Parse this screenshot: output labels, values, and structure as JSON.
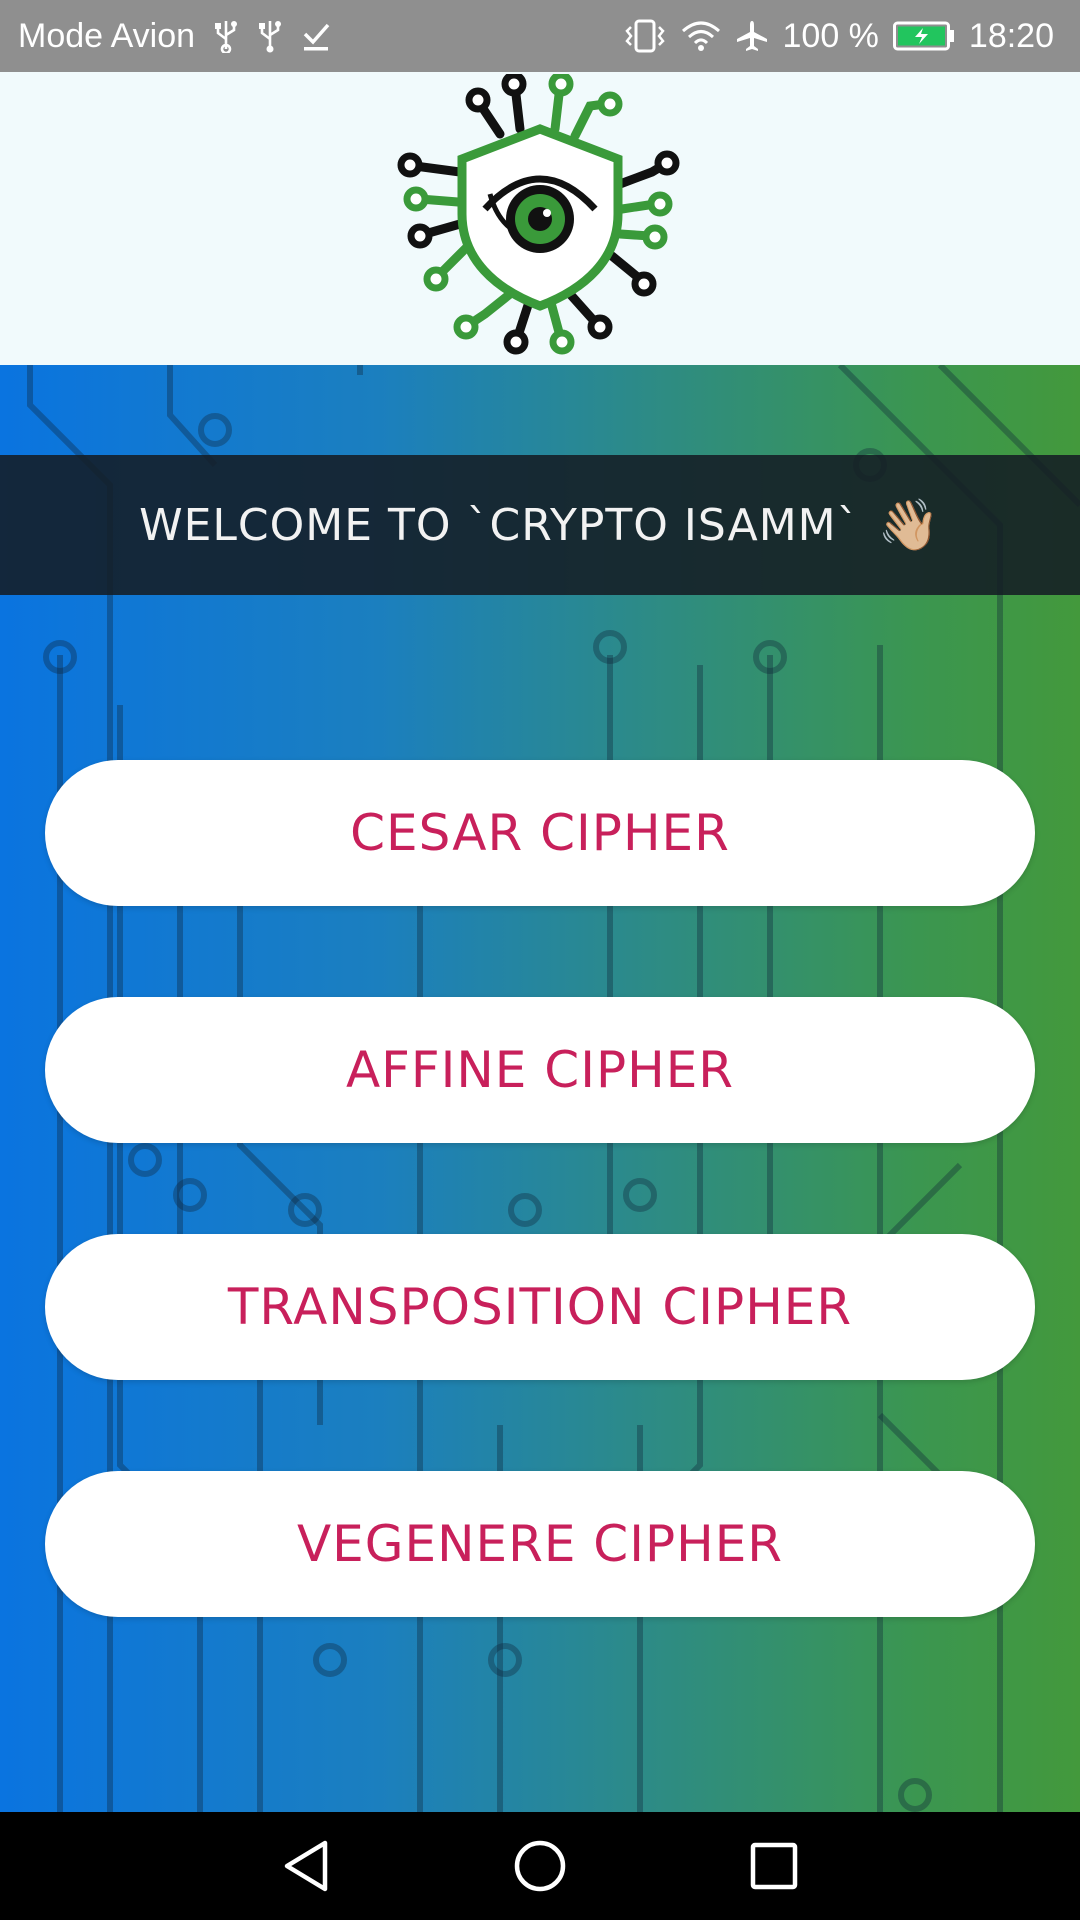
{
  "status_bar": {
    "carrier": "Mode Avion",
    "battery_percent": "100 %",
    "time": "18:20",
    "icons": [
      "usb-icon",
      "usb-icon",
      "download-done-icon",
      "vibrate-icon",
      "wifi-icon",
      "airplane-icon",
      "battery-charging-icon"
    ],
    "battery_color": "#22c55e"
  },
  "header": {
    "logo": "eye-shield-circuit-logo"
  },
  "welcome": {
    "text": "WELCOME TO `CRYPTO ISAMM`",
    "emoji": "👋🏼"
  },
  "buttons": [
    {
      "label": "CESAR CIPHER"
    },
    {
      "label": "AFFINE CIPHER"
    },
    {
      "label": "TRANSPOSITION CIPHER"
    },
    {
      "label": "VEGENERE CIPHER"
    }
  ],
  "theme": {
    "button_text_color": "#c8205b",
    "gradient_start": "#0a74e0",
    "gradient_end": "#43993c",
    "logo_green": "#3a9a3a",
    "logo_black": "#111111"
  },
  "nav_bar": {
    "icons": [
      "back-icon",
      "home-icon",
      "recents-icon"
    ]
  }
}
